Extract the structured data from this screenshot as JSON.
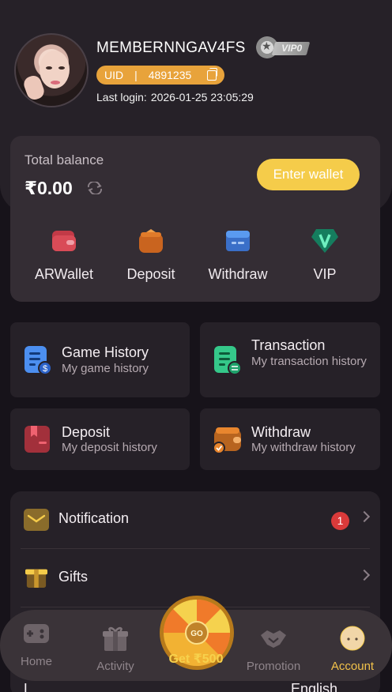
{
  "profile": {
    "username": "MEMBERNNGAV4FS",
    "vip_level": "VIP0",
    "uid_label": "UID",
    "uid_separator": "|",
    "uid_value": "4891235",
    "last_login_label": "Last login:",
    "last_login_value": "2026-01-25 23:05:29"
  },
  "balance": {
    "label": "Total balance",
    "amount": "₹0.00",
    "enter_wallet": "Enter wallet",
    "items": [
      {
        "label": "ARWallet",
        "icon": "arwallet-icon",
        "color": "#d94b57"
      },
      {
        "label": "Deposit",
        "icon": "deposit-bag-icon",
        "color": "#e07b2a"
      },
      {
        "label": "Withdraw",
        "icon": "withdraw-card-icon",
        "color": "#4a8ee8"
      },
      {
        "label": "VIP",
        "icon": "vip-diamond-icon",
        "color": "#1e9e78"
      }
    ]
  },
  "history": [
    {
      "title": "Game History",
      "subtitle": "My game history",
      "icon": "game-history-icon",
      "color": "#4c8ff0"
    },
    {
      "title": "Transaction",
      "subtitle": "My transaction history",
      "icon": "transaction-icon",
      "color": "#35c88a"
    },
    {
      "title": "Deposit",
      "subtitle": "My deposit history",
      "icon": "deposit-history-icon",
      "color": "#d9424f"
    },
    {
      "title": "Withdraw",
      "subtitle": "My withdraw history",
      "icon": "withdraw-history-icon",
      "color": "#e8862e"
    }
  ],
  "settings": {
    "notification_label": "Notification",
    "notification_count": "1",
    "gifts_label": "Gifts",
    "partial_row_left": "L",
    "partial_row_right": "English"
  },
  "tabbar": {
    "home": "Home",
    "activity": "Activity",
    "promo_label": "Get ₹500",
    "wheel_center": "GO",
    "promotion": "Promotion",
    "account": "Account"
  },
  "colors": {
    "accent": "#f5cc4a",
    "uid_bg": "#e8a33b",
    "card_bg": "#342d34",
    "panel_bg": "#262128"
  }
}
